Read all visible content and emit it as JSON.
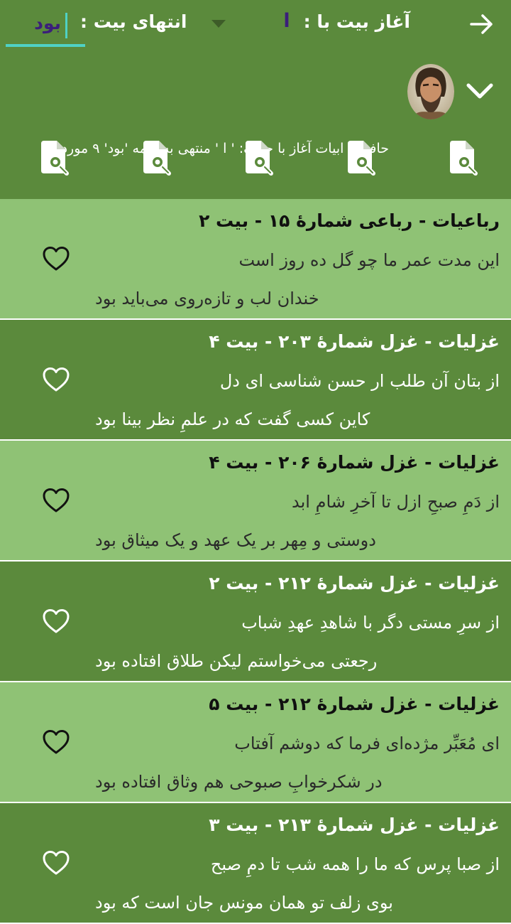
{
  "header": {
    "start_label": "آغاز بیت با :",
    "start_value": "ا",
    "end_label": "انتهای بیت :",
    "end_value": "بود"
  },
  "info": {
    "text": "حافظ - ابیات  آغاز با حرف: ' ا '  منتهی به کلمه 'بود' ۹ مورد"
  },
  "colors": {
    "primary": "#5b8a3c",
    "light": "#8fc275",
    "accent": "#4fd1c5",
    "value_text": "#3b1f7a"
  },
  "results": [
    {
      "title": "رباعیات - رباعی شمارهٔ ۱۵ - بیت ۲",
      "verse1": "این مدت عمر ما چو گل ده روز است",
      "verse2": "خندان لب و تازه‌روی می‌باید بود",
      "shade": "light"
    },
    {
      "title": "غزلیات - غزل شمارهٔ ۲۰۳ - بیت ۴",
      "verse1": "از بتان آن طلب ار حسن شناسی ای دل",
      "verse2": "کاین کسی گفت که در علمِ نظر بینا بود",
      "shade": "dark"
    },
    {
      "title": "غزلیات - غزل شمارهٔ ۲۰۶ - بیت ۴",
      "verse1": "از دَمِ صبحِ ازل تا آخرِ شامِ ابد",
      "verse2": "دوستی و مِهر بر یک عهد و یک میثاق بود",
      "shade": "light"
    },
    {
      "title": "غزلیات - غزل شمارهٔ ۲۱۲ - بیت ۲",
      "verse1": "از سرِ مستی دگر با شاهدِ عهدِ شباب",
      "verse2": "رجعتی می‌خواستم لیکن طلاق افتاده بود",
      "shade": "dark"
    },
    {
      "title": "غزلیات - غزل شمارهٔ ۲۱۲ - بیت ۵",
      "verse1": "ای مُعَبِّر مژده‌ای فرما که دوشم آفتاب",
      "verse2": "در شکرخوابِ صبوحی هم وثاق افتاده بود",
      "shade": "light"
    },
    {
      "title": "غزلیات - غزل شمارهٔ ۲۱۳ - بیت ۳",
      "verse1": "از صبا پرس که ما را همه شب تا دمِ صبح",
      "verse2": "بوی زلف تو همان مونس جان است که بود",
      "shade": "dark"
    }
  ]
}
